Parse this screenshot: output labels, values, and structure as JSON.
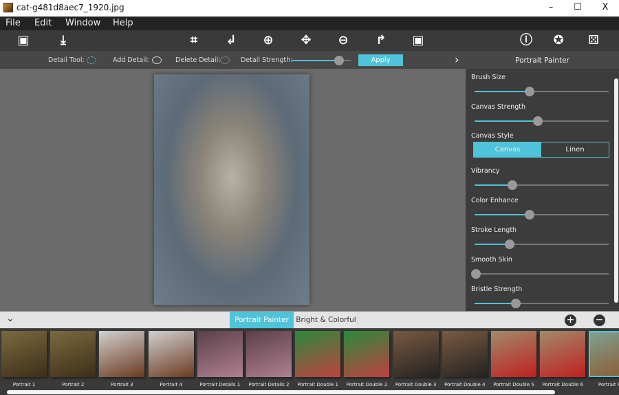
{
  "window": {
    "title": "cat-g481d8aec7_1920.jpg",
    "controls": [
      "–",
      "☐",
      "X"
    ]
  },
  "menu": [
    "File",
    "Edit",
    "Window",
    "Help"
  ],
  "toolbar": {
    "icons": [
      "open-image-icon",
      "save-icon",
      "crop-icon",
      "undo-icon",
      "zoom-in-icon",
      "pan-icon",
      "zoom-out-icon",
      "redo-icon",
      "compare-icon",
      "info-icon",
      "settings-icon",
      "random-icon"
    ]
  },
  "subbar": {
    "detail_tool": "Detail Tool:",
    "add_detail": "Add Detail:",
    "delete_detail": "Delete Detail:",
    "detail_strength": "Detail Strength:",
    "detail_strength_value": 0.8,
    "apply": "Apply",
    "expand": "›"
  },
  "panel": {
    "title": "Portrait Painter",
    "sliders": [
      {
        "label": "Brush Size",
        "value": 0.41
      },
      {
        "label": "Canvas Strength",
        "value": 0.47
      },
      {
        "label": "Vibrancy",
        "value": 0.28
      },
      {
        "label": "Color Enhance",
        "value": 0.41
      },
      {
        "label": "Stroke Length",
        "value": 0.26
      },
      {
        "label": "Smooth Skin",
        "value": 0.01
      },
      {
        "label": "Bristle Strength",
        "value": 0.31
      }
    ],
    "canvas_style": {
      "label": "Canvas Style",
      "options": [
        "Canvas",
        "Linen"
      ],
      "selected": "Canvas"
    }
  },
  "bottom": {
    "collapse": "⌄",
    "tabs": [
      "Portrait Painter",
      "Bright & Colorful"
    ],
    "active_tab": "Portrait Painter",
    "add": "+",
    "remove": "−"
  },
  "presets": [
    "Portrait 1",
    "Portrait 2",
    "Portrait 3",
    "Portrait 4",
    "Portrait Details 1",
    "Portrait Details 2",
    "Portrait Double 1",
    "Portrait Double 2",
    "Portrait Double 3",
    "Portrait Double 4",
    "Portrait Double 5",
    "Portrait Double 6",
    "Portrait Pet"
  ],
  "colors": {
    "accent": "#4fc3d9"
  }
}
